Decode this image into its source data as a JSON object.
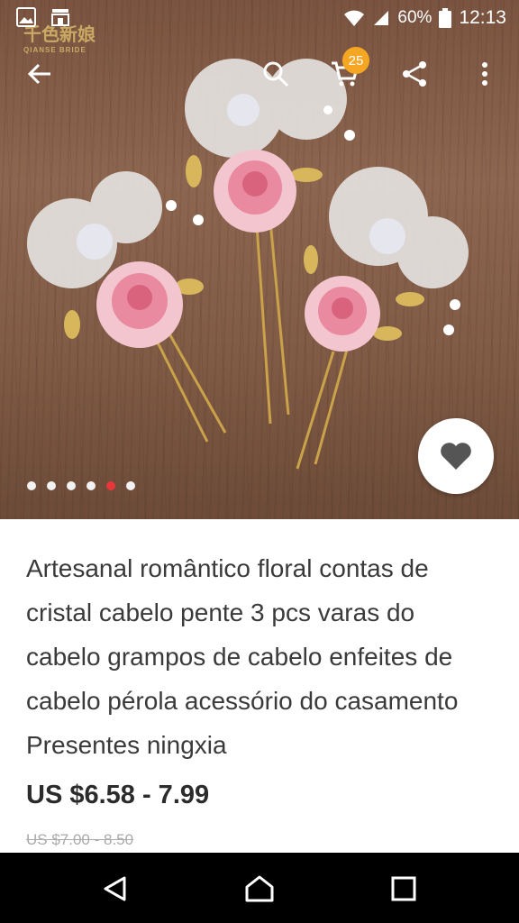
{
  "status_bar": {
    "battery": "60%",
    "time": "12:13"
  },
  "watermark": {
    "text": "千色新娘",
    "subtext": "QIANSE BRIDE"
  },
  "toolbar": {
    "cart_count": "25"
  },
  "gallery": {
    "image_count": 6,
    "active_index": 4
  },
  "product": {
    "title": "Artesanal romântico floral contas de cristal cabelo pente 3 pcs varas do cabelo grampos de cabelo enfeites de cabelo pérola acessório do casamento Presentes ningxia",
    "price": "US $6.58 - 7.99",
    "original_price": "US $7.00 - 8.50"
  },
  "colors": {
    "accent": "#e8373a",
    "badge": "#f5a623",
    "wood": "#7f5a45",
    "rose": "#e98aa0"
  },
  "icons": {
    "back": "arrow-left",
    "search": "search",
    "cart": "cart",
    "share": "share",
    "more": "more-vertical",
    "favorite": "heart",
    "nav_back": "triangle-back",
    "nav_home": "home",
    "nav_recents": "square"
  }
}
